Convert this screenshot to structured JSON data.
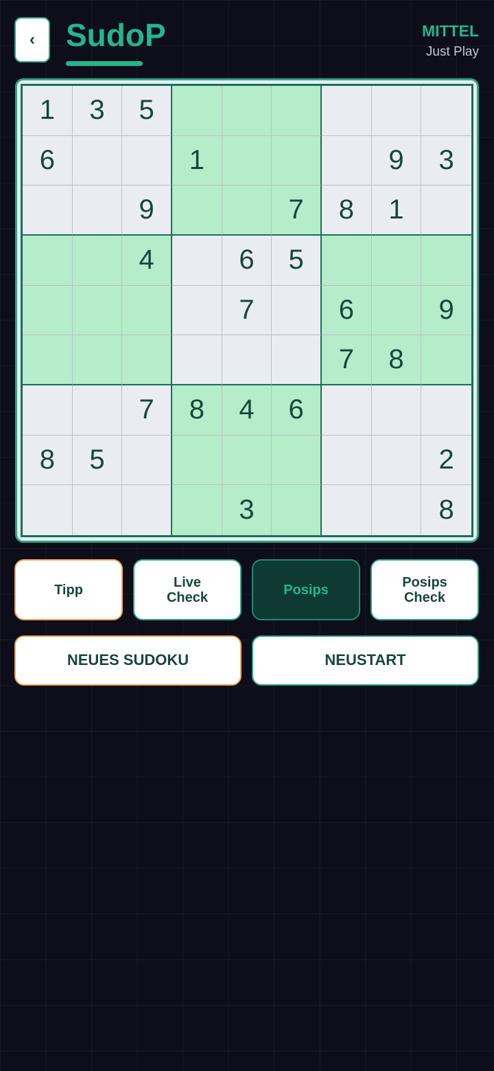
{
  "header": {
    "back_label": "‹",
    "title": "SudoP",
    "difficulty": "MITTEL",
    "mode": "Just Play"
  },
  "board": {
    "cells": [
      [
        "1",
        "3",
        "5",
        "",
        "",
        "",
        "",
        "",
        ""
      ],
      [
        "6",
        "",
        "",
        "1",
        "",
        "",
        "",
        "9",
        "3"
      ],
      [
        "",
        "",
        "9",
        "",
        "",
        "7",
        "8",
        "1",
        ""
      ],
      [
        "",
        "",
        "4",
        "",
        "6",
        "5",
        "",
        "",
        ""
      ],
      [
        "",
        "",
        "",
        "",
        "7",
        "",
        "6",
        "",
        "9"
      ],
      [
        "",
        "",
        "",
        "",
        "",
        "",
        "7",
        "8",
        ""
      ],
      [
        "",
        "",
        "7",
        "8",
        "4",
        "6",
        "",
        "",
        ""
      ],
      [
        "8",
        "5",
        "",
        "",
        "",
        "",
        "",
        "",
        "2"
      ],
      [
        "",
        "",
        "",
        "",
        "3",
        "",
        "",
        "",
        "8"
      ]
    ],
    "highlighted_boxes": [
      1,
      3,
      5,
      7
    ]
  },
  "actions": {
    "tipp": "Tipp",
    "live_check_1": "Live",
    "live_check_2": "Check",
    "posips": "Posips",
    "posips_check_1": "Posips",
    "posips_check_2": "Check",
    "new_sudoku": "NEUES SUDOKU",
    "restart": "NEUSTART"
  },
  "colors": {
    "accent": "#25b58b",
    "highlight": "#b5ecc9",
    "cell": "#e9edf1",
    "digit": "#17463c",
    "orange": "#f0a456",
    "background": "#0e0d1a"
  }
}
